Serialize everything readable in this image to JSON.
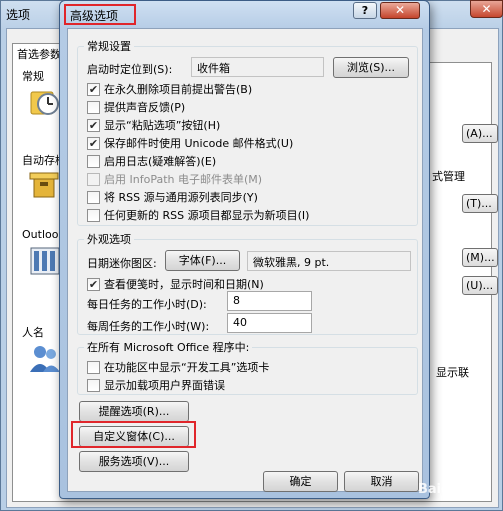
{
  "parent": {
    "title": "选项",
    "close_glyph": "✕",
    "tab_label": "首选参数",
    "sections": {
      "general": "常规",
      "autoarchive": "自动存档",
      "outlook": "Outlook",
      "names": "人名"
    },
    "right_texts": {
      "archive_mgmt": "式管理",
      "show_contacts": "显示联"
    },
    "right_buttons": [
      "(A)...",
      "(T)...",
      "(M)...",
      "(U)..."
    ]
  },
  "dialog": {
    "title": "高级选项",
    "help_glyph": "?",
    "close_glyph": "✕",
    "general_settings": {
      "legend": "常规设置",
      "startup_label": "启动时定位到(S):",
      "startup_value": "收件箱",
      "browse_button": "浏览(S)...",
      "options": [
        {
          "label": "在永久删除项目前提出警告(B)",
          "checked": true,
          "enabled": true
        },
        {
          "label": "提供声音反馈(P)",
          "checked": false,
          "enabled": true
        },
        {
          "label": "显示“粘贴选项”按钮(H)",
          "checked": true,
          "enabled": true
        },
        {
          "label": "保存邮件时使用 Unicode 邮件格式(U)",
          "checked": true,
          "enabled": true
        },
        {
          "label": "启用日志(疑难解答)(E)",
          "checked": false,
          "enabled": true
        },
        {
          "label": "启用 InfoPath 电子邮件表单(M)",
          "checked": false,
          "enabled": false
        },
        {
          "label": "将 RSS 源与通用源列表同步(Y)",
          "checked": false,
          "enabled": true
        },
        {
          "label": "任何更新的 RSS 源项目都显示为新项目(I)",
          "checked": false,
          "enabled": true
        }
      ]
    },
    "appearance": {
      "legend": "外观选项",
      "date_label": "日期迷你图区:",
      "font_button": "字体(F)...",
      "font_value": "微软雅黑, 9 pt.",
      "show_notes": {
        "label": "查看便笺时，显示时间和日期(N)",
        "checked": true
      },
      "daily_hours_label": "每日任务的工作小时(D):",
      "daily_hours_value": "8",
      "weekly_hours_label": "每周任务的工作小时(W):",
      "weekly_hours_value": "40"
    },
    "office": {
      "legend": "在所有 Microsoft Office 程序中:",
      "options": [
        {
          "label": "在功能区中显示“开发工具”选项卡",
          "checked": false
        },
        {
          "label": "显示加载项用户界面错误",
          "checked": false
        }
      ]
    },
    "buttons": {
      "reminder": "提醒选项(R)...",
      "custom_forms": "自定义窗体(C)...",
      "service": "服务选项(V)...",
      "ok": "确定",
      "cancel": "取消"
    },
    "check_glyph": "✔"
  },
  "watermark": "Baidu 经验"
}
